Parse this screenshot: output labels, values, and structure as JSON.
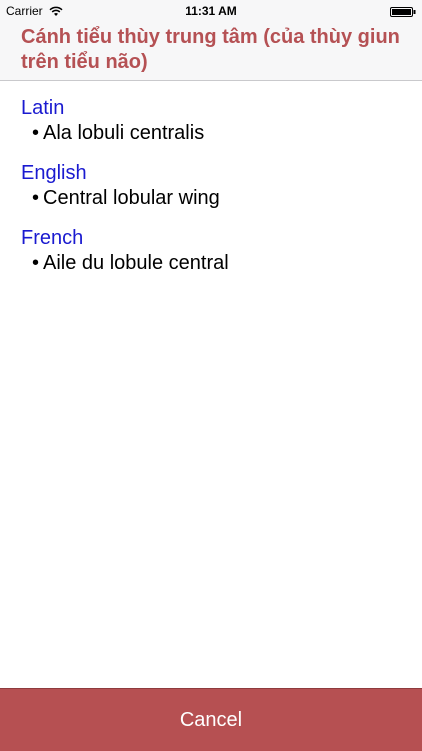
{
  "status_bar": {
    "carrier": "Carrier",
    "time": "11:31 AM"
  },
  "header": {
    "title": "Cánh tiểu thùy trung tâm (của thùy giun trên tiểu não)"
  },
  "colors": {
    "header_title": "#b55154",
    "section_title": "#1a1ad0",
    "cancel_bar": "#b65052"
  },
  "sections": [
    {
      "language": "Latin",
      "term": "Ala lobuli centralis"
    },
    {
      "language": "English",
      "term": "Central lobular wing"
    },
    {
      "language": "French",
      "term": "Aile du lobule central"
    }
  ],
  "cancel_label": "Cancel"
}
